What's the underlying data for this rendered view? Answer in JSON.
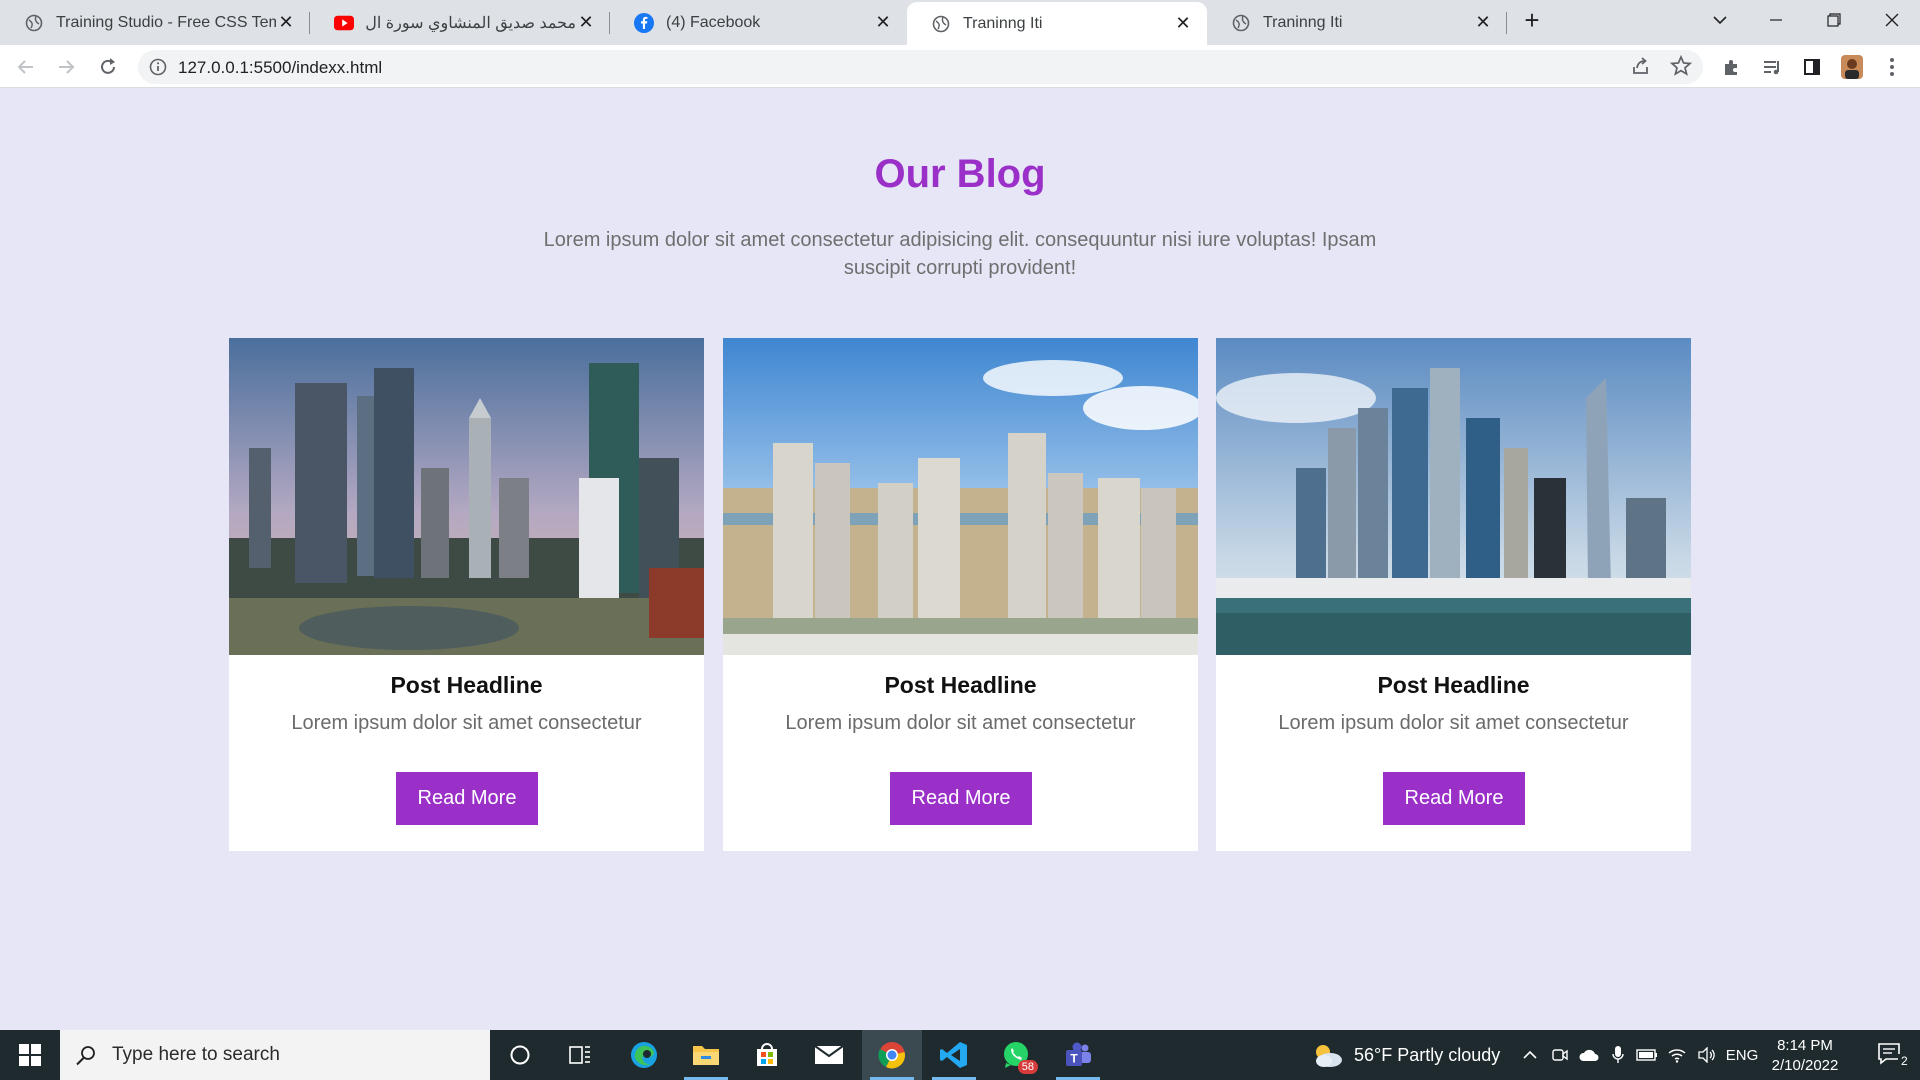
{
  "browser": {
    "tabs": [
      {
        "title": "Training Studio - Free CSS Templ",
        "icon": "globe-icon"
      },
      {
        "title": "محمد صديق المنشاوي سورة ال عمـ",
        "icon": "youtube-icon"
      },
      {
        "title": "(4) Facebook",
        "icon": "facebook-icon"
      },
      {
        "title": "Traninng Iti",
        "icon": "globe-icon"
      },
      {
        "title": "Traninng Iti",
        "icon": "globe-icon"
      }
    ],
    "active_tab": 3,
    "url": "127.0.0.1:5500/indexx.html",
    "colors": {
      "tabbar": "#dee1e6",
      "toolbar": "#ffffff",
      "omnibox": "#f1f3f4"
    }
  },
  "page": {
    "title": "Our Blog",
    "description": "Lorem ipsum dolor sit amet consectetur adipisicing elit. consequuntur nisi iure voluptas! Ipsam suscipit corrupti provident!",
    "colors": {
      "background": "#e6e6f7",
      "accent": "#9b30c8",
      "card": "#ffffff",
      "muted_text": "#6b6b6b"
    },
    "posts": [
      {
        "headline": "Post Headline",
        "excerpt": "Lorem ipsum dolor sit amet consectetur",
        "button": "Read More",
        "image": "city-skyline-sunset"
      },
      {
        "headline": "Post Headline",
        "excerpt": "Lorem ipsum dolor sit amet consectetur",
        "button": "Read More",
        "image": "residential-towers"
      },
      {
        "headline": "Post Headline",
        "excerpt": "Lorem ipsum dolor sit amet consectetur",
        "button": "Read More",
        "image": "marina-skyscrapers"
      }
    ]
  },
  "taskbar": {
    "search_placeholder": "Type here to search",
    "apps": [
      "cortana-icon",
      "task-view-icon",
      "edge-icon",
      "file-explorer-icon",
      "store-icon",
      "mail-icon",
      "chrome-icon",
      "vscode-icon",
      "whatsapp-icon",
      "teams-icon"
    ],
    "whatsapp_badge": "58",
    "weather": "56°F  Partly cloudy",
    "language": "ENG",
    "time": "8:14 PM",
    "date": "2/10/2022",
    "notification_count": "2"
  }
}
